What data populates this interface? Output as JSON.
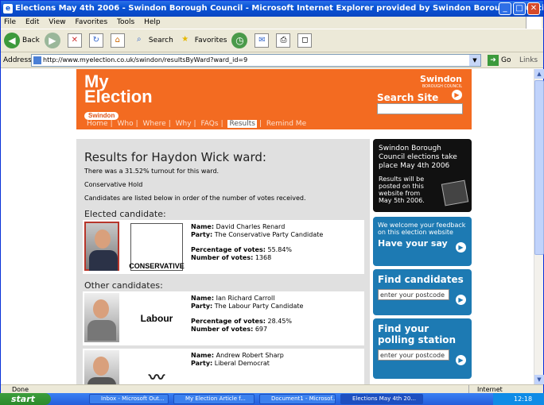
{
  "window": {
    "title": "Elections May 4th 2006 - Swindon Borough Council - Microsoft Internet Explorer provided by Swindon Borough Council"
  },
  "menu": [
    "File",
    "Edit",
    "View",
    "Favorites",
    "Tools",
    "Help"
  ],
  "toolbar": {
    "back": "Back",
    "search": "Search",
    "favorites": "Favorites"
  },
  "addressbar": {
    "label": "Address",
    "url": "http://www.myelection.co.uk/swindon/resultsByWard?ward_id=9",
    "go": "Go",
    "links": "Links"
  },
  "site": {
    "logo_line1": "My",
    "logo_line2": "Election",
    "logo_sub": "Swindon",
    "council_name": "Swindon",
    "council_sub": "BOROUGH COUNCIL",
    "search_label": "Search Site",
    "nav": [
      "Home",
      "Who",
      "Where",
      "Why",
      "FAQs",
      "Results",
      "Remind Me"
    ],
    "nav_active": "Results"
  },
  "results": {
    "title": "Results for Haydon Wick ward:",
    "turnout": "There was a 31.52% turnout for this ward.",
    "outcome": "Conservative Hold",
    "note": "Candidates are listed below in order of the number of votes received.",
    "elected_heading": "Elected candidate:",
    "others_heading": "Other candidates:",
    "labels": {
      "name": "Name:",
      "party": "Party:",
      "percentage": "Percentage of votes:",
      "votes": "Number of votes:"
    },
    "elected": {
      "name": "David Charles Renard",
      "party": "The Conservative Party Candidate",
      "percentage": "55.84%",
      "votes": "1368",
      "logo_text": "CONSERVATIVE"
    },
    "others": [
      {
        "name": "Ian Richard Carroll",
        "party": "The Labour Party Candidate",
        "percentage": "28.45%",
        "votes": "697",
        "logo_text": "Labour"
      },
      {
        "name": "Andrew Robert Sharp",
        "party": "Liberal Democrat"
      }
    ]
  },
  "sidebar": {
    "info_title": "Swindon Borough Council elections take place May 4th 2006",
    "info_small": "Results will be posted on this website from May 5th 2006.",
    "feedback_text": "We welcome your feedback on this election website",
    "feedback_link": "Have your say",
    "find_candidates": "Find candidates",
    "find_polling": "Find your polling station",
    "postcode_placeholder": "enter your postcode"
  },
  "status": {
    "text": "Done",
    "zone": "Internet"
  },
  "taskbar": {
    "start": "start",
    "tasks": [
      "Inbox - Microsoft Out...",
      "My Election Article f...",
      "Document1 - Microsof...",
      "Elections May 4th 20..."
    ],
    "clock": "12:18"
  }
}
